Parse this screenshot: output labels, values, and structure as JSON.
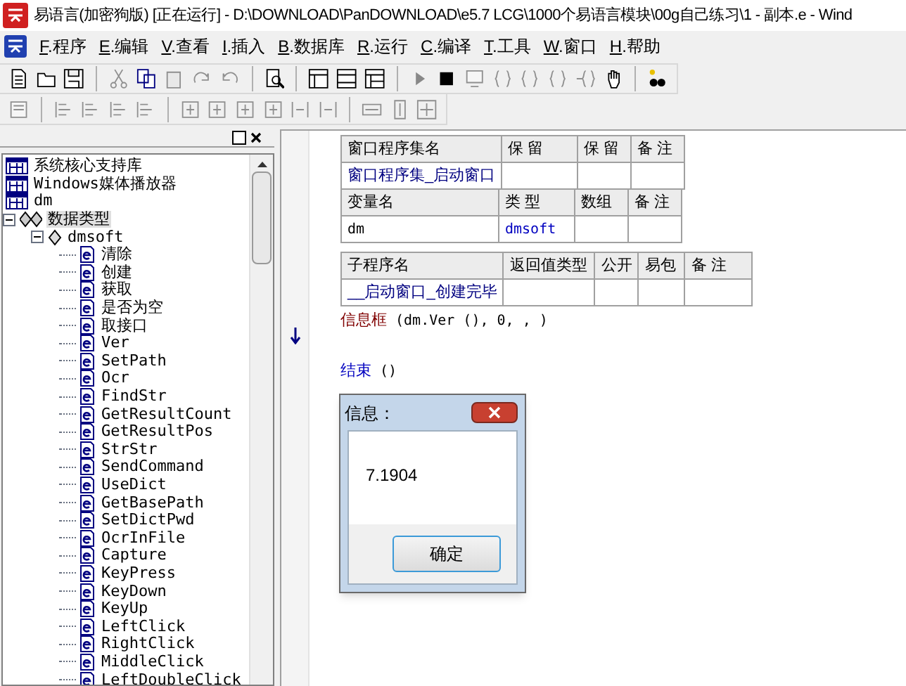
{
  "window": {
    "title": "易语言(加密狗版) [正在运行] - D:\\DOWNLOAD\\PanDOWNLOAD\\e5.7 LCG\\1000个易语言模块\\00g自己练习\\1 - 副本.e - Wind"
  },
  "menu": [
    {
      "key": "F",
      "label": ".程序"
    },
    {
      "key": "E",
      "label": ".编辑"
    },
    {
      "key": "V",
      "label": ".查看"
    },
    {
      "key": "I",
      "label": ".插入"
    },
    {
      "key": "B",
      "label": ".数据库"
    },
    {
      "key": "R",
      "label": ".运行"
    },
    {
      "key": "C",
      "label": ".编译"
    },
    {
      "key": "T",
      "label": ".工具"
    },
    {
      "key": "W",
      "label": ".窗口"
    },
    {
      "key": "H",
      "label": ".帮助"
    }
  ],
  "tree": [
    {
      "label": "系统核心支持库",
      "kind": "library",
      "selected": false
    },
    {
      "label": "Windows媒体播放器",
      "kind": "library",
      "selected": false
    },
    {
      "label": "dm",
      "kind": "library",
      "selected": false
    },
    {
      "label": "数据类型",
      "kind": "types",
      "selected": true,
      "expanded": true,
      "children": [
        {
          "label": "dmsoft",
          "kind": "class",
          "selected": false,
          "expanded": true,
          "children": [
            {
              "label": "清除",
              "kind": "method",
              "selected": false
            },
            {
              "label": "创建",
              "kind": "method",
              "selected": false
            },
            {
              "label": "获取",
              "kind": "method",
              "selected": false
            },
            {
              "label": "是否为空",
              "kind": "method",
              "selected": false
            },
            {
              "label": "取接口",
              "kind": "method",
              "selected": false
            },
            {
              "label": "Ver",
              "kind": "method",
              "selected": false
            },
            {
              "label": "SetPath",
              "kind": "method",
              "selected": false
            },
            {
              "label": "Ocr",
              "kind": "method",
              "selected": false
            },
            {
              "label": "FindStr",
              "kind": "method",
              "selected": false
            },
            {
              "label": "GetResultCount",
              "kind": "method",
              "selected": false
            },
            {
              "label": "GetResultPos",
              "kind": "method",
              "selected": false
            },
            {
              "label": "StrStr",
              "kind": "method",
              "selected": false
            },
            {
              "label": "SendCommand",
              "kind": "method",
              "selected": false
            },
            {
              "label": "UseDict",
              "kind": "method",
              "selected": false
            },
            {
              "label": "GetBasePath",
              "kind": "method",
              "selected": false
            },
            {
              "label": "SetDictPwd",
              "kind": "method",
              "selected": false
            },
            {
              "label": "OcrInFile",
              "kind": "method",
              "selected": false
            },
            {
              "label": "Capture",
              "kind": "method",
              "selected": false
            },
            {
              "label": "KeyPress",
              "kind": "method",
              "selected": false
            },
            {
              "label": "KeyDown",
              "kind": "method",
              "selected": false
            },
            {
              "label": "KeyUp",
              "kind": "method",
              "selected": false
            },
            {
              "label": "LeftClick",
              "kind": "method",
              "selected": false
            },
            {
              "label": "RightClick",
              "kind": "method",
              "selected": false
            },
            {
              "label": "MiddleClick",
              "kind": "method",
              "selected": false
            },
            {
              "label": "LeftDoubleClick",
              "kind": "method",
              "selected": false
            }
          ]
        }
      ]
    }
  ],
  "program_table": {
    "columns": [
      "窗口程序集名",
      "保 留",
      "保 留",
      "备 注"
    ],
    "rows": [
      [
        "窗口程序集_启动窗口",
        "",
        "",
        ""
      ]
    ]
  },
  "variable_table": {
    "columns": [
      "变量名",
      "类 型",
      "数组",
      "备 注"
    ],
    "rows": [
      [
        "dm",
        "dmsoft",
        "",
        ""
      ]
    ]
  },
  "sub_table": {
    "columns": [
      "子程序名",
      "返回值类型",
      "公开",
      "易包",
      "备 注"
    ],
    "rows": [
      [
        "__启动窗口_创建完毕",
        "",
        "",
        "",
        ""
      ]
    ]
  },
  "code": [
    {
      "kind": "call",
      "name": "信息框",
      "args": " (dm.Ver (), 0, , )"
    },
    {
      "kind": "end",
      "name": "结束",
      "args": " ()"
    }
  ],
  "dialog": {
    "title": "信息：",
    "message": "7.1904",
    "button": "确定"
  }
}
